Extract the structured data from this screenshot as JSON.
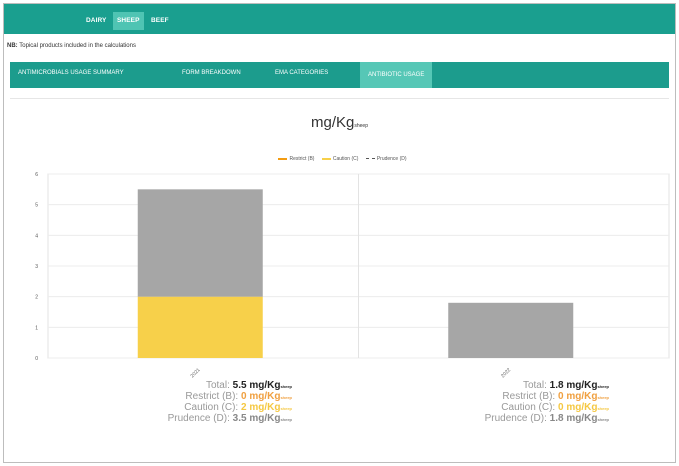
{
  "topnav": {
    "tabs": [
      {
        "label": "DAIRY"
      },
      {
        "label": "SHEEP"
      },
      {
        "label": "BEEF"
      }
    ],
    "active": "SHEEP"
  },
  "note": {
    "prefix": "NB:",
    "text": "Topical products included in the calculations"
  },
  "subnav": {
    "tabs": [
      {
        "label": "ANTIMICROBIALS USAGE SUMMARY"
      },
      {
        "label": "FORM BREAKDOWN"
      },
      {
        "label": "EMA CATEGORIES"
      },
      {
        "label": "ANTIBIOTIC USAGE"
      }
    ],
    "active": "ANTIBIOTIC USAGE"
  },
  "chart": {
    "title_main": "mg/Kg",
    "title_sub": "sheep"
  },
  "legend": {
    "items": [
      {
        "label": "Restrict (B)"
      },
      {
        "label": "Caution (C)"
      },
      {
        "label": "Prudence (D)"
      }
    ]
  },
  "colors": {
    "restrict": "#f39c12",
    "caution": "#f7d04a",
    "prudence": "#a6a6a6",
    "accent": "#1a9f8f"
  },
  "summaries": [
    {
      "total_label": "Total:",
      "total_value": "5.5 mg/Kg",
      "total_unit": "sheep",
      "restrict_label": "Restrict (B):",
      "restrict_value": "0 mg/Kg",
      "restrict_unit": "sheep",
      "caution_label": "Caution (C):",
      "caution_value": "2 mg/Kg",
      "caution_unit": "sheep",
      "prudence_label": "Prudence (D):",
      "prudence_value": "3.5 mg/Kg",
      "prudence_unit": "sheep"
    },
    {
      "total_label": "Total:",
      "total_value": "1.8 mg/Kg",
      "total_unit": "sheep",
      "restrict_label": "Restrict (B):",
      "restrict_value": "0 mg/Kg",
      "restrict_unit": "sheep",
      "caution_label": "Caution (C):",
      "caution_value": "0 mg/Kg",
      "caution_unit": "sheep",
      "prudence_label": "Prudence (D):",
      "prudence_value": "1.8 mg/Kg",
      "prudence_unit": "sheep"
    }
  ],
  "chart_data": {
    "type": "bar",
    "stacked": true,
    "categories": [
      "2021",
      "2022"
    ],
    "series": [
      {
        "name": "Restrict (B)",
        "values": [
          0,
          0
        ]
      },
      {
        "name": "Caution (C)",
        "values": [
          2,
          0
        ]
      },
      {
        "name": "Prudence (D)",
        "values": [
          3.5,
          1.8
        ]
      }
    ],
    "yticks": [
      "0",
      "1",
      "2",
      "3",
      "4",
      "5",
      "6"
    ],
    "ylim": [
      0,
      6
    ],
    "grid": true,
    "legend_position": "top"
  }
}
